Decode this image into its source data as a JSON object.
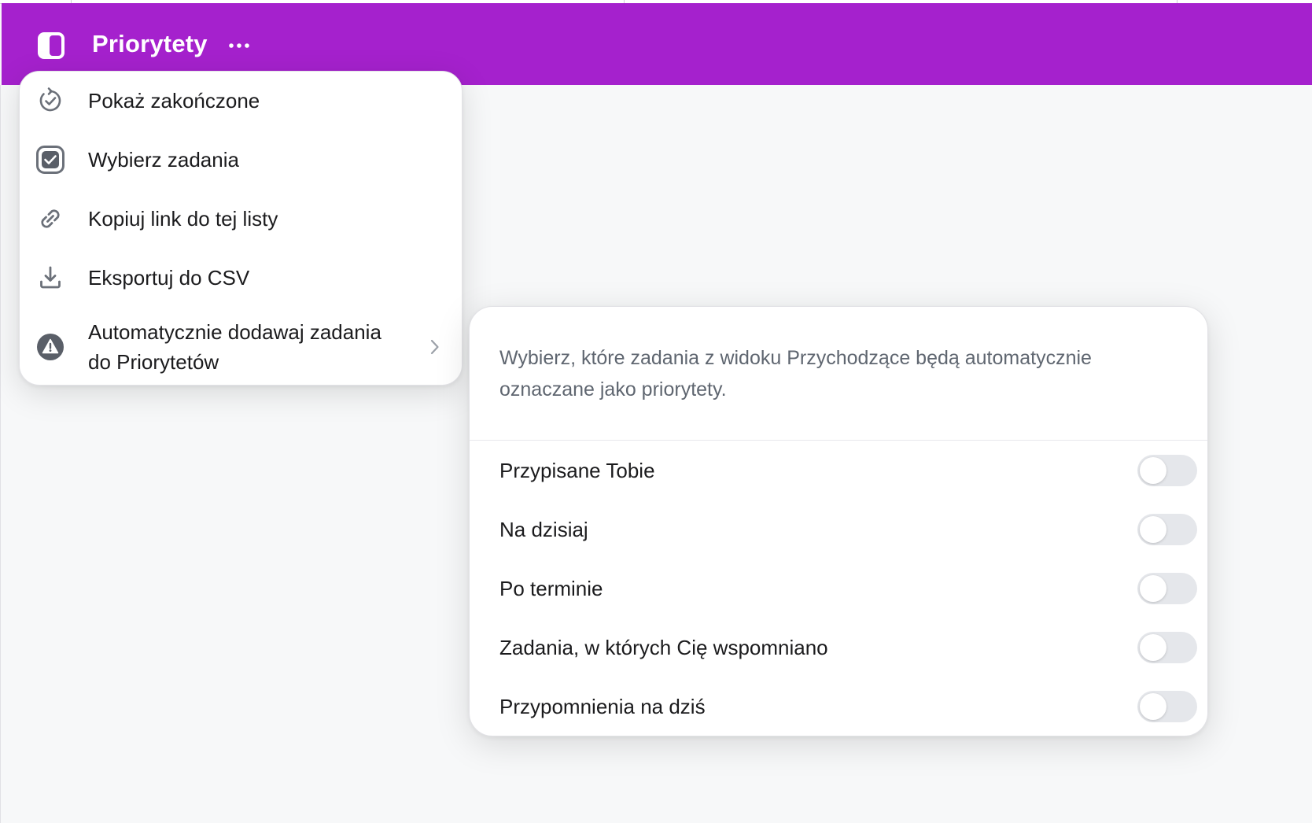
{
  "header": {
    "title": "Priorytety",
    "background": "#a521cd",
    "panel_icon": "sidebar-toggle-icon",
    "more_icon": "ellipsis-icon"
  },
  "menu": {
    "items": [
      {
        "label": "Pokaż zakończone",
        "icon": "circular-check-icon"
      },
      {
        "label": "Wybierz zadania",
        "icon": "checkbox-square-icon"
      },
      {
        "label": "Kopiuj link do tej listy",
        "icon": "link-icon"
      },
      {
        "label": "Eksportuj do CSV",
        "icon": "download-icon"
      },
      {
        "label_line1": "Automatycznie dodawaj zadania",
        "label_line2": "do Priorytetów",
        "icon": "warning-icon",
        "has_submenu": true
      }
    ]
  },
  "panel": {
    "description": "Wybierz, które zadania z widoku Przychodzące będą automatycznie oznaczane jako priorytety.",
    "options": [
      {
        "label": "Przypisane Tobie",
        "enabled": false
      },
      {
        "label": "Na dzisiaj",
        "enabled": false
      },
      {
        "label": "Po terminie",
        "enabled": false
      },
      {
        "label": "Zadania, w których Cię wspomniano",
        "enabled": false
      },
      {
        "label": "Przypomnienia na dziś",
        "enabled": false
      }
    ]
  }
}
